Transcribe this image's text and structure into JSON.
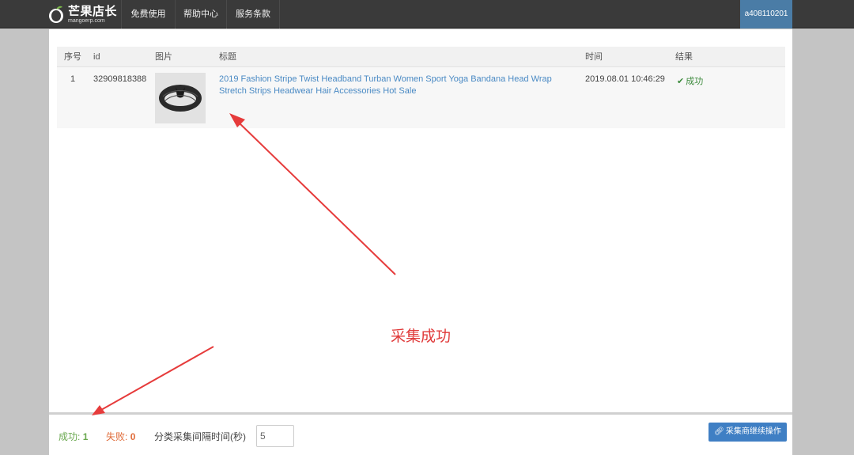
{
  "navbar": {
    "brand": {
      "name": "芒果店长",
      "domain": "mangoerp.com"
    },
    "items": [
      {
        "label": "免费使用"
      },
      {
        "label": "帮助中心"
      },
      {
        "label": "服务条款"
      }
    ],
    "user": "a408110201"
  },
  "table": {
    "headers": {
      "index": "序号",
      "id": "id",
      "image": "图片",
      "title": "标题",
      "time": "时间",
      "result": "结果"
    },
    "rows": [
      {
        "index": "1",
        "id": "32909818388",
        "title": "2019 Fashion Stripe Twist Headband Turban Women Sport Yoga Bandana Head Wrap Stretch Strips Headwear Hair Accessories Hot Sale",
        "time": "2019.08.01 10:46:29",
        "result": "成功",
        "result_icon": "check-icon"
      }
    ]
  },
  "annotation": "采集成功",
  "footer": {
    "success_label": "成功:",
    "success_count": "1",
    "fail_label": "失败:",
    "fail_count": "0",
    "interval_label": "分类采集间隔时间(秒)",
    "interval_value": "5",
    "action_button": "采集商继续操作",
    "action_icon": "link-icon"
  },
  "colors": {
    "navbar": "#3a3a3a",
    "user_box": "#4a7ca6",
    "link": "#4a8ac4",
    "success": "#6aa84f",
    "fail": "#e06c3a",
    "annotation": "#e03a3a",
    "button": "#3f7fc4"
  }
}
